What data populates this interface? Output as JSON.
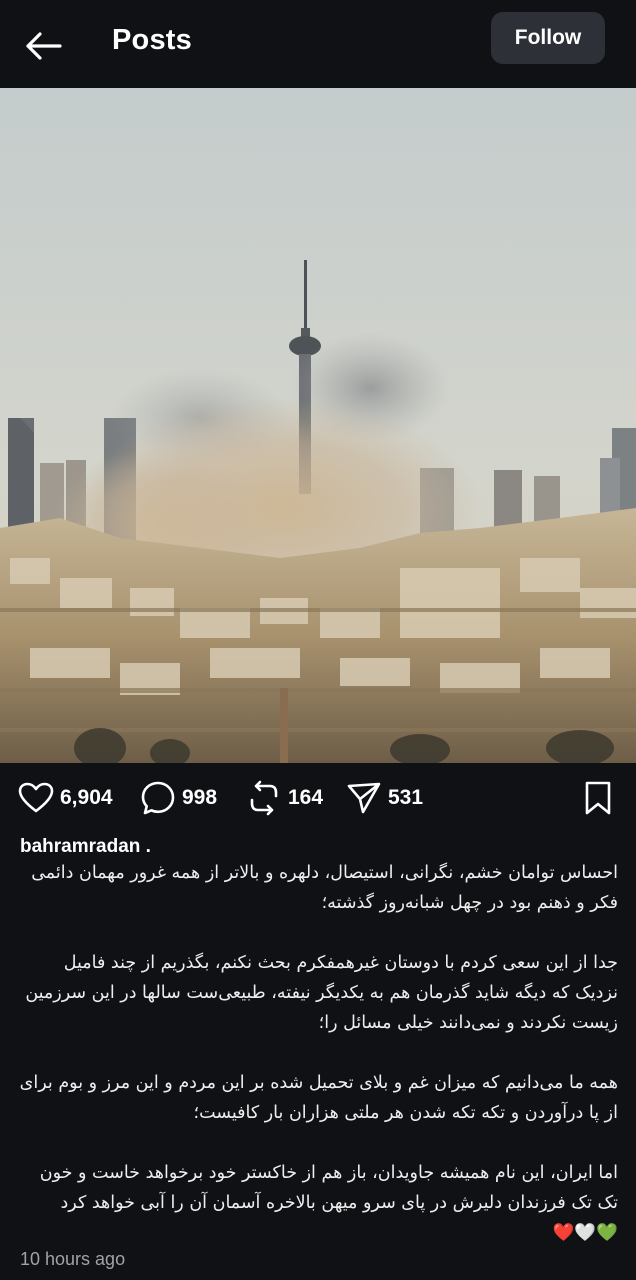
{
  "header": {
    "title": "Posts",
    "follow_label": "Follow"
  },
  "photo": {
    "alt": "Skyline of Tehran with Milad Tower and a large dust cloud"
  },
  "actions": {
    "likes": "6,904",
    "comments": "998",
    "reposts": "164",
    "shares": "531"
  },
  "post": {
    "username": "bahramradan .",
    "caption": [
      "احساس توامان خشم، نگرانی، استیصال، دلهره و بالاتر از همه غرور مهمان دائمی فکر و ذهنم بود در چهل شبانه‌روز گذشته؛",
      "جدا از این سعی کردم با دوستان غیرهمفکرم بحث نکنم، بگذریم از چند فامیل نزدیک که دیگه شاید گذرمان هم به یکدیگر نیفته، طبیعی‌ست سالها در این سرزمین زیست نکردند و نمی‌دانند خیلی مسائل را؛",
      "همه ما می‌دانیم که میزان غم و بلای تحمیل شده بر این مردم و این مرز و بوم برای از پا درآوردن و تکه تکه شدن هر ملتی هزاران بار کافیست؛",
      "اما ایران، این نام همیشه جاویدان، باز هم از خاکستر خود برخواهد خاست و خون تک تک فرزندان دلیرش در پای سرو میهن بالاخره آسمان آن را آبی خواهد کرد"
    ],
    "caption_emoji": "❤️🤍💚",
    "timestamp": "10 hours ago"
  },
  "colors": {
    "background": "#0f1115",
    "button_bg": "#2d3137",
    "text": "#ffffff",
    "muted": "#9ea3a8"
  }
}
